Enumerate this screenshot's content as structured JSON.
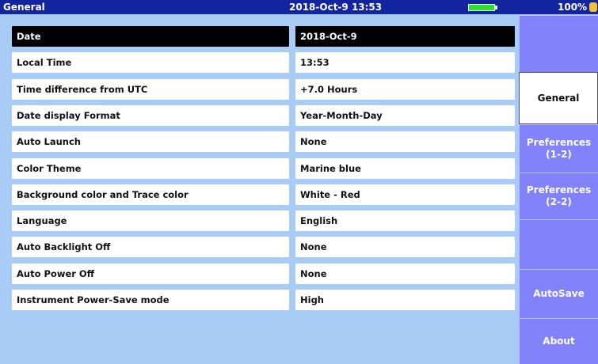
{
  "titlebar": {
    "title": "General",
    "datetime": "2018-Oct-9 13:53",
    "battery_percent": "100%"
  },
  "settings": [
    {
      "label": "Date",
      "value": "2018-Oct-9"
    },
    {
      "label": "Local Time",
      "value": "13:53"
    },
    {
      "label": "Time difference from UTC",
      "value": "+7.0 Hours"
    },
    {
      "label": "Date display Format",
      "value": "Year-Month-Day"
    },
    {
      "label": "Auto Launch",
      "value": "None"
    },
    {
      "label": "Color Theme",
      "value": "Marine blue"
    },
    {
      "label": "Background color and Trace color",
      "value": "White - Red"
    },
    {
      "label": "Language",
      "value": "English"
    },
    {
      "label": "Auto Backlight Off",
      "value": "None"
    },
    {
      "label": "Auto Power Off",
      "value": "None"
    },
    {
      "label": "Instrument Power-Save mode",
      "value": "High"
    }
  ],
  "sidebar": [
    {
      "label": ""
    },
    {
      "label": "General"
    },
    {
      "label": "Preferences\n(1-2)"
    },
    {
      "label": "Preferences\n(2-2)"
    },
    {
      "label": ""
    },
    {
      "label": "AutoSave"
    },
    {
      "label": "About"
    }
  ],
  "colors": {
    "titlebar": "#13259e",
    "background": "#a8ccf5",
    "sidebar_button": "#8283fb",
    "selected_row": "#000000",
    "battery": "#2fe02f"
  }
}
